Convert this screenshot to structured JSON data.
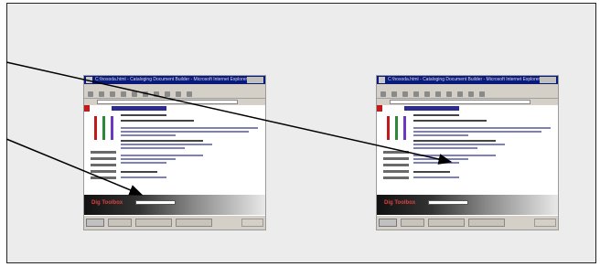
{
  "shots": [
    {
      "id": "left",
      "window_title": "C:\\hosoda.html - Cataloging Document Builder - Microsoft Internet Explorer",
      "footer_brand": "Dig Toolbox",
      "pointer": "arrow"
    },
    {
      "id": "right",
      "window_title": "C:\\hosoda.html - Cataloging Document Builder - Microsoft Internet Explorer",
      "footer_brand": "Dig Toolbox",
      "pointer": "arrow"
    }
  ],
  "colors": {
    "frame_bg": "#ececec",
    "titlebar": "#0a1a7a",
    "accent_red": "#c21a1a",
    "logo_bars": [
      "#c21a1a",
      "#2a8a3a",
      "#6b3ac2"
    ]
  }
}
